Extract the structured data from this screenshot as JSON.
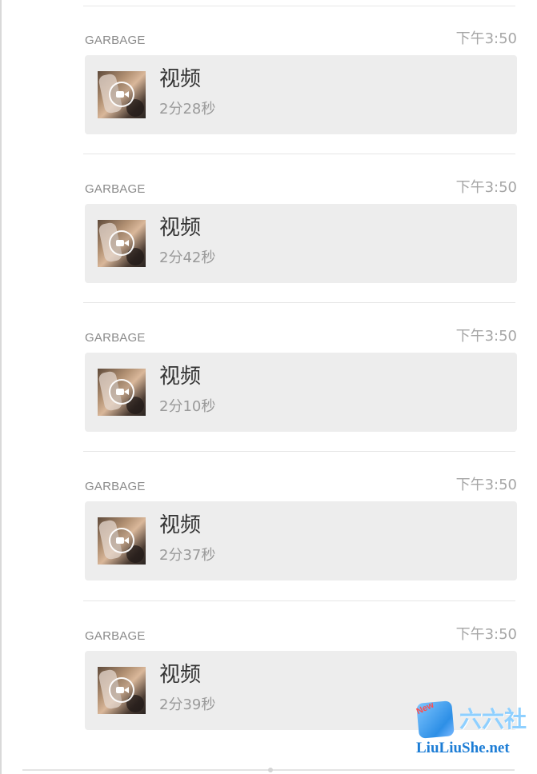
{
  "messages": [
    {
      "sender": "GARBAGE",
      "time": "下午3:50",
      "title": "视频",
      "duration": "2分28秒"
    },
    {
      "sender": "GARBAGE",
      "time": "下午3:50",
      "title": "视频",
      "duration": "2分42秒"
    },
    {
      "sender": "GARBAGE",
      "time": "下午3:50",
      "title": "视频",
      "duration": "2分10秒"
    },
    {
      "sender": "GARBAGE",
      "time": "下午3:50",
      "title": "视频",
      "duration": "2分37秒"
    },
    {
      "sender": "GARBAGE",
      "time": "下午3:50",
      "title": "视频",
      "duration": "2分39秒"
    }
  ],
  "watermark": {
    "badge": "New",
    "name": "六六社",
    "url": "LiuLiuShe.net"
  },
  "icons": {
    "video": "video-camera-icon"
  },
  "colors": {
    "bubble": "#ededed",
    "secondary_text": "#9a9a9a",
    "primary_text": "#333333"
  }
}
